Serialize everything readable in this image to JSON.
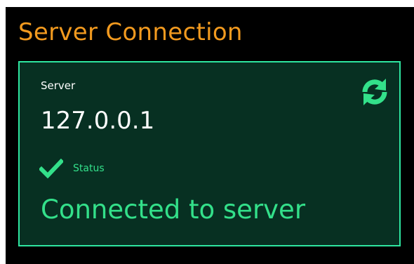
{
  "page": {
    "title": "Server Connection"
  },
  "server": {
    "label": "Server",
    "value": "127.0.0.1"
  },
  "status": {
    "label": "Status",
    "value": "Connected to server",
    "icon": "checkmark-icon"
  },
  "actions": {
    "refresh_icon": "refresh-icon"
  },
  "colors": {
    "background": "#000000",
    "title": "#f29a1f",
    "panel_background": "#073022",
    "panel_border": "#2ee6a0",
    "accent": "#33e08a",
    "text": "#ffffff"
  }
}
